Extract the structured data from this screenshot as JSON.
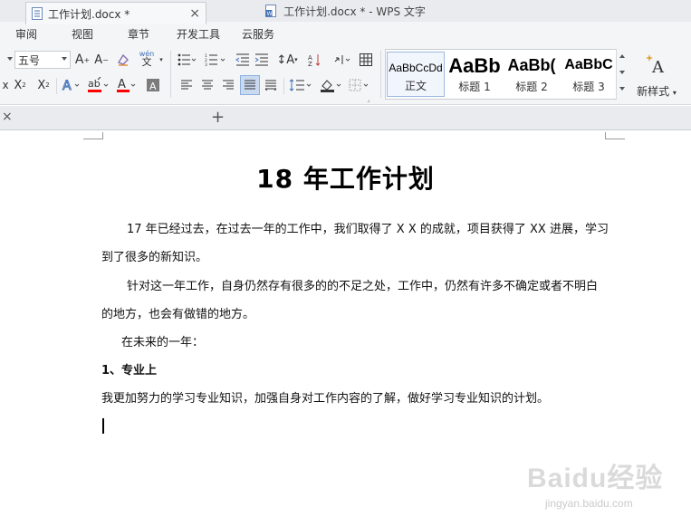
{
  "window": {
    "title": "工作计划.docx * - WPS 文字"
  },
  "menu": {
    "items": [
      "审阅",
      "视图",
      "章节",
      "开发工具",
      "云服务"
    ]
  },
  "ribbon": {
    "font_size_value": "五号",
    "styles": [
      {
        "sample": "AaBbCcDd",
        "name": "正文"
      },
      {
        "sample": "AaBb",
        "name": "标题 1"
      },
      {
        "sample": "AaBb(",
        "name": "标题 2"
      },
      {
        "sample": "AaBbC",
        "name": "标题 3"
      }
    ],
    "new_style_label": "新样式",
    "phonetic_top": "wén",
    "phonetic_bottom": "文"
  },
  "tabs": {
    "active_label": "工作计划.docx *"
  },
  "document": {
    "title": "18 年工作计划",
    "paragraphs": [
      {
        "text": "17 年已经过去，在过去一年的工作中，我们取得了 X X 的成就，项目获得了 XX 进展，学习到了很多的新知识。",
        "style": "indent"
      },
      {
        "text": "针对这一年工作，自身仍然存有很多的的不足之处，工作中，仍然有许多不确定或者不明白的地方，也会有做错的地方。",
        "style": "indent"
      },
      {
        "text": "在未来的一年：",
        "style": "indent"
      },
      {
        "text": "1、专业上",
        "style": "heading"
      },
      {
        "text": "我更加努力的学习专业知识，加强自身对工作内容的了解，做好学习专业知识的计划。",
        "style": "plain"
      }
    ]
  },
  "watermark": {
    "brand": "Baidu经验",
    "url": "jingyan.baidu.com"
  },
  "colors": {
    "font_color_underline": "#ff0000",
    "highlight_underline": "#ff0000",
    "accent": "#3f6fb5"
  }
}
